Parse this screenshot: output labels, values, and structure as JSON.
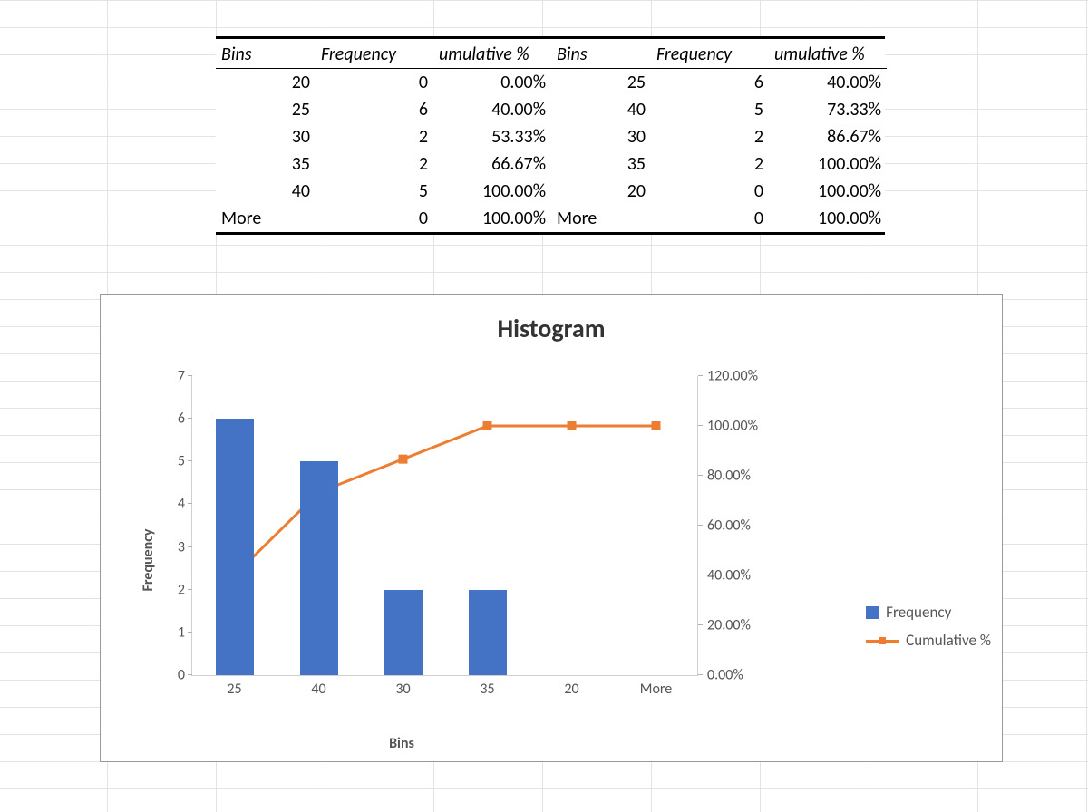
{
  "table": {
    "headers": {
      "left": {
        "bins": "Bins",
        "freq": "Frequency",
        "cum": "umulative %"
      },
      "right": {
        "bins": "Bins",
        "freq": "Frequency",
        "cum": "umulative %"
      }
    },
    "rows": [
      {
        "lb": "20",
        "lf": "0",
        "lc": "0.00%",
        "rb": "25",
        "rf": "6",
        "rc": "40.00%"
      },
      {
        "lb": "25",
        "lf": "6",
        "lc": "40.00%",
        "rb": "40",
        "rf": "5",
        "rc": "73.33%"
      },
      {
        "lb": "30",
        "lf": "2",
        "lc": "53.33%",
        "rb": "30",
        "rf": "2",
        "rc": "86.67%"
      },
      {
        "lb": "35",
        "lf": "2",
        "lc": "66.67%",
        "rb": "35",
        "rf": "2",
        "rc": "100.00%"
      },
      {
        "lb": "40",
        "lf": "5",
        "lc": "100.00%",
        "rb": "20",
        "rf": "0",
        "rc": "100.00%"
      },
      {
        "lb": "More",
        "lf": "0",
        "lc": "100.00%",
        "rb": "More",
        "rf": "0",
        "rc": "100.00%"
      }
    ]
  },
  "chart_data": {
    "type": "bar",
    "title": "Histogram",
    "xlabel": "Bins",
    "ylabel": "Frequency",
    "categories": [
      "25",
      "40",
      "30",
      "35",
      "20",
      "More"
    ],
    "series": [
      {
        "name": "Frequency",
        "kind": "bar",
        "axis": "left",
        "values": [
          6,
          5,
          2,
          2,
          0,
          0
        ],
        "color": "#4472c4"
      },
      {
        "name": "Cumulative %",
        "kind": "line",
        "axis": "right",
        "values": [
          40.0,
          73.33,
          86.67,
          100.0,
          100.0,
          100.0
        ],
        "color": "#ed7d31"
      }
    ],
    "y_left": {
      "min": 0,
      "max": 7,
      "ticks": [
        0,
        1,
        2,
        3,
        4,
        5,
        6,
        7
      ]
    },
    "y_right": {
      "min": 0,
      "max": 120,
      "ticks": [
        "0.00%",
        "20.00%",
        "40.00%",
        "60.00%",
        "80.00%",
        "100.00%",
        "120.00%"
      ]
    },
    "legend": [
      "Frequency",
      "Cumulative %"
    ]
  }
}
